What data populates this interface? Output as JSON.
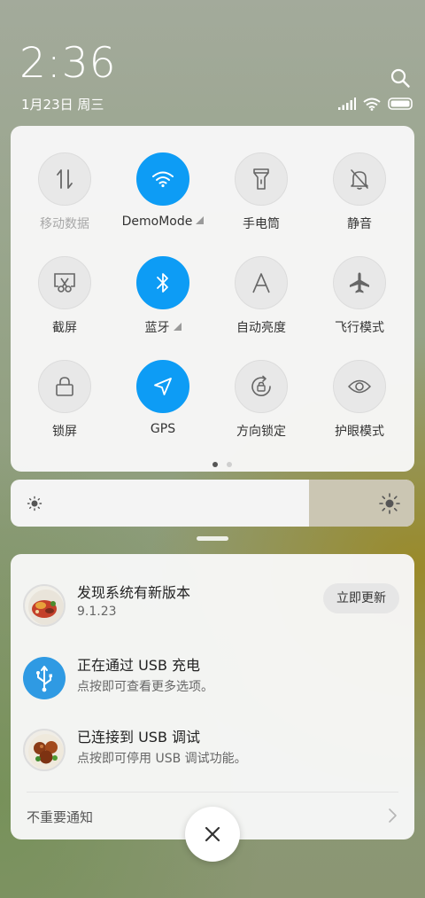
{
  "status_bar": {
    "time": "2:36",
    "date": "1月23日 周三"
  },
  "quick_settings": {
    "tiles": [
      {
        "label": "移动数据",
        "icon": "mobile-data-icon",
        "active": false,
        "dim": true
      },
      {
        "label": "DemoMode",
        "icon": "wifi-icon",
        "active": true,
        "expand": true
      },
      {
        "label": "手电筒",
        "icon": "flashlight-icon",
        "active": false
      },
      {
        "label": "静音",
        "icon": "mute-bell-icon",
        "active": false
      },
      {
        "label": "截屏",
        "icon": "screenshot-icon",
        "active": false
      },
      {
        "label": "蓝牙",
        "icon": "bluetooth-icon",
        "active": true,
        "expand": true
      },
      {
        "label": "自动亮度",
        "icon": "auto-brightness-icon",
        "active": false
      },
      {
        "label": "飞行模式",
        "icon": "airplane-icon",
        "active": false
      },
      {
        "label": "锁屏",
        "icon": "lock-icon",
        "active": false
      },
      {
        "label": "GPS",
        "icon": "gps-icon",
        "active": true
      },
      {
        "label": "方向锁定",
        "icon": "rotation-lock-icon",
        "active": false
      },
      {
        "label": "护眼模式",
        "icon": "eye-icon",
        "active": false
      }
    ],
    "page_count": 2,
    "current_page": 1
  },
  "brightness": {
    "level": 0.74,
    "low_icon": "brightness-low-icon",
    "high_icon": "brightness-high-icon"
  },
  "notifications": {
    "items": [
      {
        "title": "发现系统有新版本",
        "subtitle": "9.1.23",
        "action": "立即更新",
        "icon": "food-thumbnail"
      },
      {
        "title": "正在通过 USB 充电",
        "subtitle": "点按即可查看更多选项。",
        "icon": "usb-icon"
      },
      {
        "title": "已连接到 USB 调试",
        "subtitle": "点按即可停用 USB 调试功能。",
        "icon": "meatball-thumbnail"
      }
    ],
    "footer_label": "不重要通知"
  },
  "colors": {
    "accent": "#0d9cf5",
    "tile_inactive": "#e8e8e8",
    "icon_gray": "#666666"
  }
}
